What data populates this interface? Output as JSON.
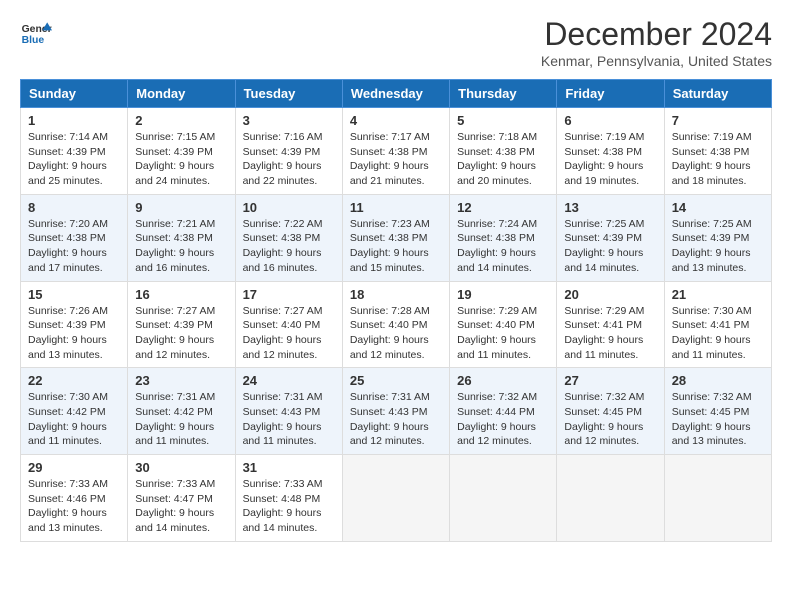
{
  "header": {
    "logo_line1": "General",
    "logo_line2": "Blue",
    "month_title": "December 2024",
    "location": "Kenmar, Pennsylvania, United States"
  },
  "days_of_week": [
    "Sunday",
    "Monday",
    "Tuesday",
    "Wednesday",
    "Thursday",
    "Friday",
    "Saturday"
  ],
  "weeks": [
    [
      {
        "day": "1",
        "rise": "7:14 AM",
        "set": "4:39 PM",
        "hours": "9 hours and 25 minutes"
      },
      {
        "day": "2",
        "rise": "7:15 AM",
        "set": "4:39 PM",
        "hours": "9 hours and 24 minutes"
      },
      {
        "day": "3",
        "rise": "7:16 AM",
        "set": "4:39 PM",
        "hours": "9 hours and 22 minutes"
      },
      {
        "day": "4",
        "rise": "7:17 AM",
        "set": "4:38 PM",
        "hours": "9 hours and 21 minutes"
      },
      {
        "day": "5",
        "rise": "7:18 AM",
        "set": "4:38 PM",
        "hours": "9 hours and 20 minutes"
      },
      {
        "day": "6",
        "rise": "7:19 AM",
        "set": "4:38 PM",
        "hours": "9 hours and 19 minutes"
      },
      {
        "day": "7",
        "rise": "7:19 AM",
        "set": "4:38 PM",
        "hours": "9 hours and 18 minutes"
      }
    ],
    [
      {
        "day": "8",
        "rise": "7:20 AM",
        "set": "4:38 PM",
        "hours": "9 hours and 17 minutes"
      },
      {
        "day": "9",
        "rise": "7:21 AM",
        "set": "4:38 PM",
        "hours": "9 hours and 16 minutes"
      },
      {
        "day": "10",
        "rise": "7:22 AM",
        "set": "4:38 PM",
        "hours": "9 hours and 16 minutes"
      },
      {
        "day": "11",
        "rise": "7:23 AM",
        "set": "4:38 PM",
        "hours": "9 hours and 15 minutes"
      },
      {
        "day": "12",
        "rise": "7:24 AM",
        "set": "4:38 PM",
        "hours": "9 hours and 14 minutes"
      },
      {
        "day": "13",
        "rise": "7:25 AM",
        "set": "4:39 PM",
        "hours": "9 hours and 14 minutes"
      },
      {
        "day": "14",
        "rise": "7:25 AM",
        "set": "4:39 PM",
        "hours": "9 hours and 13 minutes"
      }
    ],
    [
      {
        "day": "15",
        "rise": "7:26 AM",
        "set": "4:39 PM",
        "hours": "9 hours and 13 minutes"
      },
      {
        "day": "16",
        "rise": "7:27 AM",
        "set": "4:39 PM",
        "hours": "9 hours and 12 minutes"
      },
      {
        "day": "17",
        "rise": "7:27 AM",
        "set": "4:40 PM",
        "hours": "9 hours and 12 minutes"
      },
      {
        "day": "18",
        "rise": "7:28 AM",
        "set": "4:40 PM",
        "hours": "9 hours and 12 minutes"
      },
      {
        "day": "19",
        "rise": "7:29 AM",
        "set": "4:40 PM",
        "hours": "9 hours and 11 minutes"
      },
      {
        "day": "20",
        "rise": "7:29 AM",
        "set": "4:41 PM",
        "hours": "9 hours and 11 minutes"
      },
      {
        "day": "21",
        "rise": "7:30 AM",
        "set": "4:41 PM",
        "hours": "9 hours and 11 minutes"
      }
    ],
    [
      {
        "day": "22",
        "rise": "7:30 AM",
        "set": "4:42 PM",
        "hours": "9 hours and 11 minutes"
      },
      {
        "day": "23",
        "rise": "7:31 AM",
        "set": "4:42 PM",
        "hours": "9 hours and 11 minutes"
      },
      {
        "day": "24",
        "rise": "7:31 AM",
        "set": "4:43 PM",
        "hours": "9 hours and 11 minutes"
      },
      {
        "day": "25",
        "rise": "7:31 AM",
        "set": "4:43 PM",
        "hours": "9 hours and 12 minutes"
      },
      {
        "day": "26",
        "rise": "7:32 AM",
        "set": "4:44 PM",
        "hours": "9 hours and 12 minutes"
      },
      {
        "day": "27",
        "rise": "7:32 AM",
        "set": "4:45 PM",
        "hours": "9 hours and 12 minutes"
      },
      {
        "day": "28",
        "rise": "7:32 AM",
        "set": "4:45 PM",
        "hours": "9 hours and 13 minutes"
      }
    ],
    [
      {
        "day": "29",
        "rise": "7:33 AM",
        "set": "4:46 PM",
        "hours": "9 hours and 13 minutes"
      },
      {
        "day": "30",
        "rise": "7:33 AM",
        "set": "4:47 PM",
        "hours": "9 hours and 14 minutes"
      },
      {
        "day": "31",
        "rise": "7:33 AM",
        "set": "4:48 PM",
        "hours": "9 hours and 14 minutes"
      },
      null,
      null,
      null,
      null
    ]
  ],
  "labels": {
    "sunrise": "Sunrise:",
    "sunset": "Sunset:",
    "daylight": "Daylight:"
  },
  "colors": {
    "header_bg": "#1a6db5",
    "even_row": "#eef4fb",
    "odd_row": "#ffffff"
  }
}
